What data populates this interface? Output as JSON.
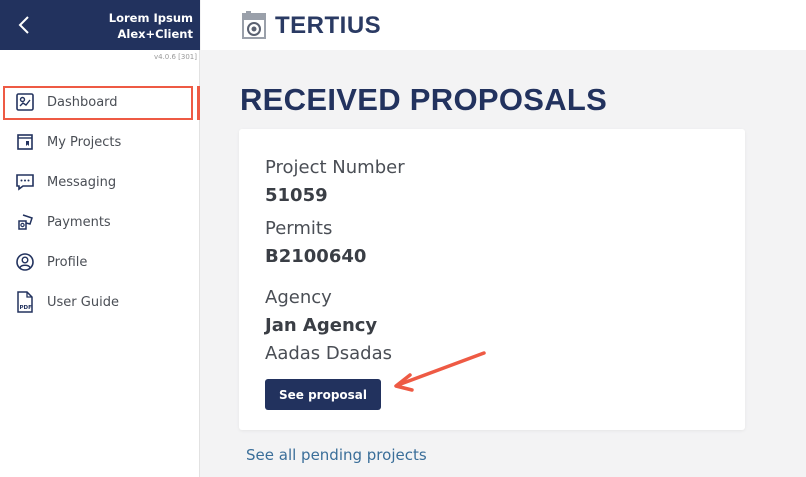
{
  "sidebar": {
    "user_line1": "Lorem Ipsum",
    "user_line2": "Alex+Client",
    "version": "v4.0.6 [301]",
    "items": [
      {
        "label": "Dashboard",
        "icon": "dashboard-icon",
        "active": true
      },
      {
        "label": "My Projects",
        "icon": "projects-icon"
      },
      {
        "label": "Messaging",
        "icon": "message-icon"
      },
      {
        "label": "Payments",
        "icon": "payments-icon"
      },
      {
        "label": "Profile",
        "icon": "profile-icon"
      },
      {
        "label": "User Guide",
        "icon": "pdf-icon"
      }
    ]
  },
  "header": {
    "brand": "TERTIUS"
  },
  "main": {
    "title": "RECEIVED PROPOSALS",
    "card": {
      "project_number_label": "Project Number",
      "project_number": "51059",
      "permits_label": "Permits",
      "permits": "B2100640",
      "agency_label": "Agency",
      "agency_name": "Jan Agency",
      "agency_contact": "Aadas Dsadas",
      "button_label": "See proposal"
    },
    "pending_link": "See all pending projects"
  },
  "colors": {
    "brand": "#22325e",
    "highlight": "#ee5a44",
    "link": "#3a6e99"
  }
}
